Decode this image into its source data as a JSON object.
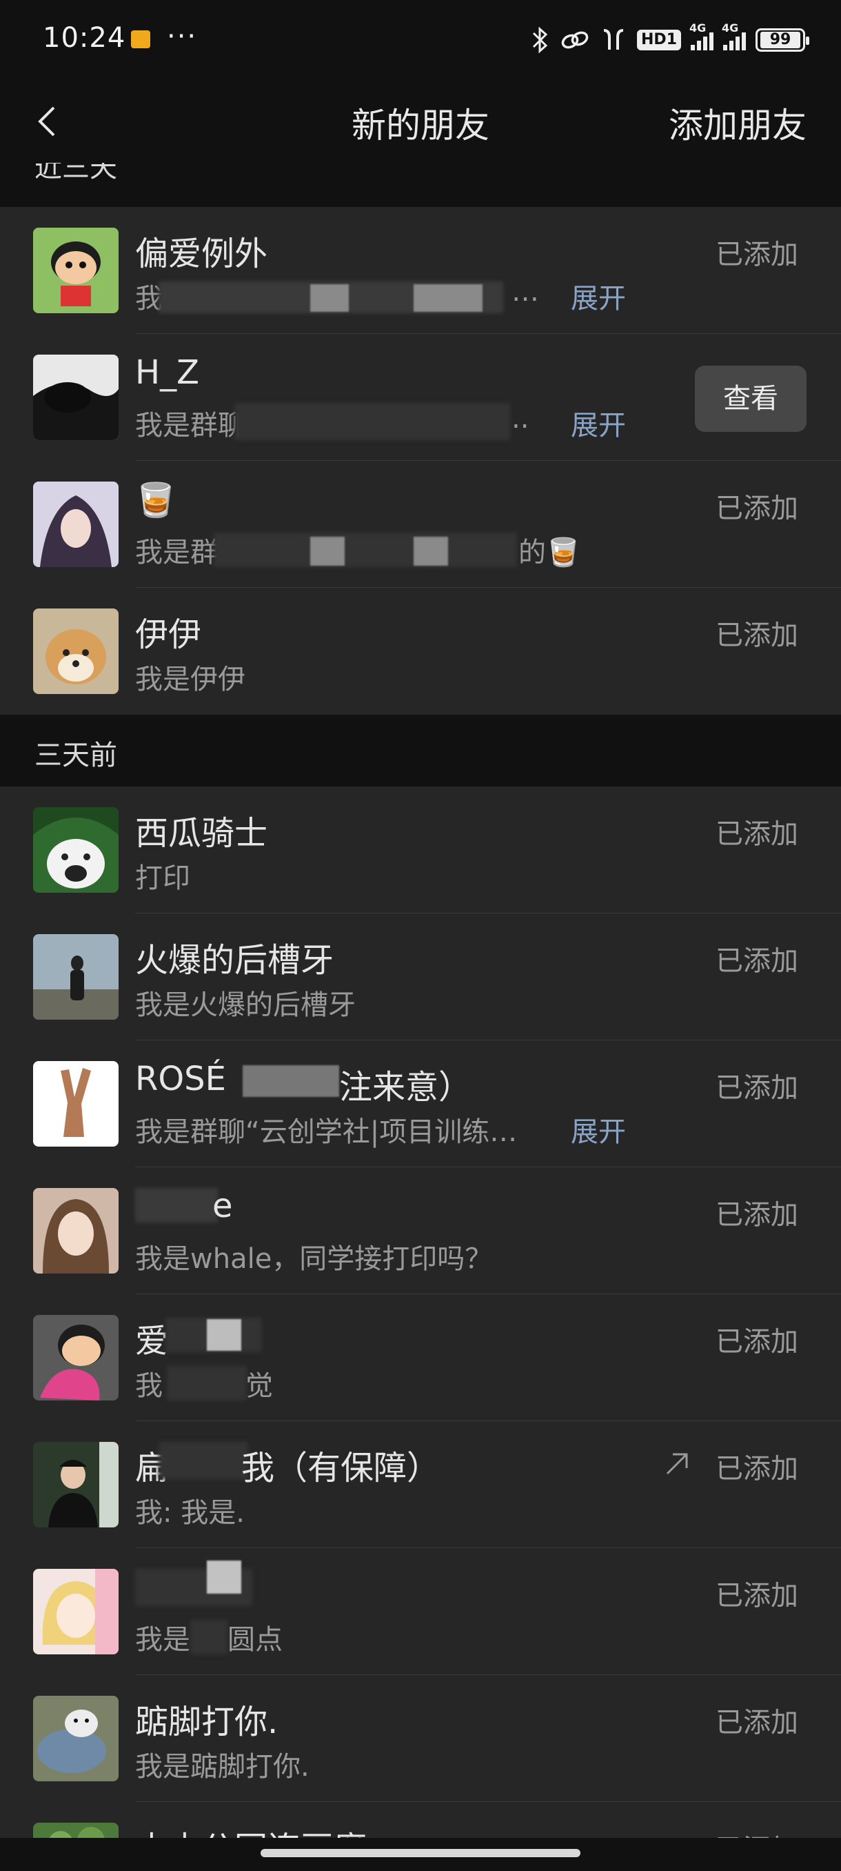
{
  "status_bar": {
    "time": "10:24",
    "more": "···",
    "icons": [
      "bluetooth-icon",
      "link-icon",
      "earbuds-icon",
      "hd-icon",
      "signal-icon",
      "signal-icon",
      "battery-icon"
    ],
    "hd_label": "HD1",
    "network_1": "4G",
    "network_2": "4G",
    "battery": "99"
  },
  "header": {
    "title": "新的朋友",
    "add_friend": "添加朋友"
  },
  "sections": {
    "recent": "近三天",
    "three_days_ago": "三天前"
  },
  "list_recent": [
    {
      "name": "偏爱例外",
      "message": "我",
      "ellipsis": "…",
      "expand": "展开",
      "status": "已添加"
    },
    {
      "name": "H_Z",
      "message": "我是群聊",
      "ellipsis": "..",
      "expand": "展开",
      "action": "查看"
    },
    {
      "name": "🥃",
      "message": "我是群",
      "message_end": "的🥃",
      "status": "已添加"
    },
    {
      "name": "伊伊",
      "message": "我是伊伊",
      "status": "已添加"
    }
  ],
  "list_older": [
    {
      "name": "西瓜骑士",
      "message": "打印",
      "status": "已添加"
    },
    {
      "name": "火爆的后槽牙",
      "message": "我是火爆的后槽牙",
      "status": "已添加"
    },
    {
      "name": "ROSÉ",
      "name_end": "注来意）",
      "message": "我是群聊“云创学社|项目训练…",
      "expand": "展开",
      "status": "已添加"
    },
    {
      "name": "e",
      "message": "我是whale，同学接打印吗？",
      "status": "已添加"
    },
    {
      "name": "爱",
      "message": "我",
      "message_end": "觉",
      "status": "已添加"
    },
    {
      "name": "扁",
      "name_end": "我（有保障）",
      "message": "我: 我是.",
      "status": "已添加"
    },
    {
      "name": "",
      "message": "我是",
      "message_end": "圆点",
      "status": "已添加"
    },
    {
      "name": "踮脚打你.",
      "message": "我是踮脚打你.",
      "status": "已添加"
    },
    {
      "name": "中中公园连豆腐",
      "status": "已添加"
    }
  ],
  "colors": {
    "background": "#111111",
    "row": "#262626",
    "link": "#8aa4c8",
    "muted": "#9a9a9a"
  }
}
